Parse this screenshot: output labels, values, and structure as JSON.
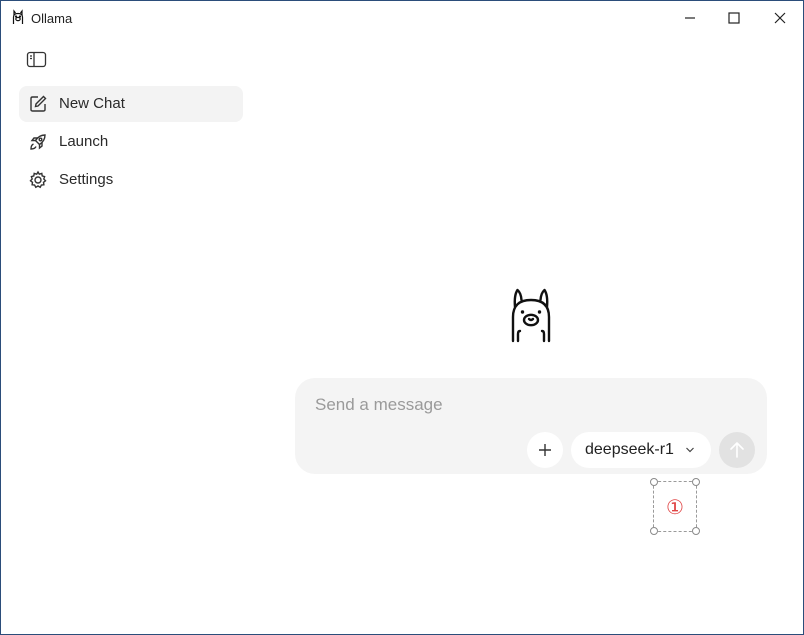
{
  "window": {
    "title": "Ollama",
    "controls": {
      "minimize_icon": "minimize-icon",
      "maximize_icon": "maximize-icon",
      "close_icon": "close-icon"
    }
  },
  "sidebar": {
    "toggle_icon": "sidebar-toggle-icon",
    "items": [
      {
        "label": "New Chat",
        "icon": "compose-icon",
        "active": true
      },
      {
        "label": "Launch",
        "icon": "rocket-icon",
        "active": false
      },
      {
        "label": "Settings",
        "icon": "gear-icon",
        "active": false
      }
    ]
  },
  "main": {
    "logo_icon": "llama-logo-icon",
    "composer": {
      "placeholder": "Send a message",
      "value": "",
      "attach_icon": "plus-icon",
      "model": "deepseek-r1",
      "model_chevron_icon": "chevron-down-icon",
      "send_icon": "arrow-up-icon"
    }
  },
  "annotation": {
    "marker": "①",
    "color": "#e04545"
  },
  "colors": {
    "composer_bg": "#f4f4f4",
    "active_item_bg": "#f3f3f3",
    "send_disabled_bg": "#e2e2e2"
  }
}
